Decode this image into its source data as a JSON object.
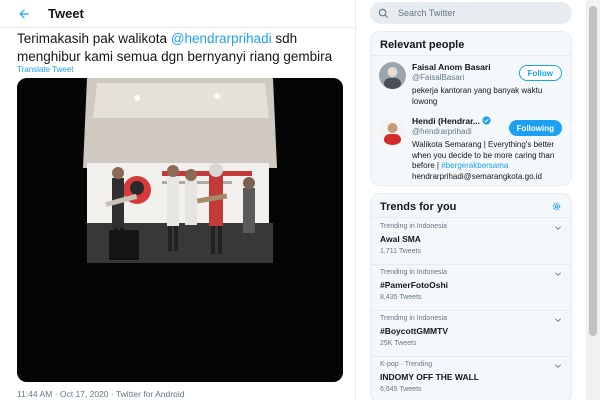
{
  "header": {
    "title": "Tweet"
  },
  "tweet": {
    "text_before": "Terimakasih pak walikota ",
    "mention": "@hendrarprihadi",
    "text_after": " sdh menghibur kami semua dgn bernyanyi riang gembira",
    "translate_label": "Translate Tweet",
    "time": "11:44 AM",
    "date": "Oct 17, 2020",
    "source": "Twitter for Android",
    "sep": " · "
  },
  "search": {
    "placeholder": "Search Twitter"
  },
  "relevant_people": {
    "title": "Relevant people",
    "people": [
      {
        "name": "Faisal Anom Basari",
        "handle": "@FaisalBasari",
        "bio": "pekerja kantoran yang banyak waktu lowong",
        "button": "Follow"
      },
      {
        "name": "Hendi (Hendrar...",
        "handle": "@hendrarprihadi",
        "bio_before": "Walikota Semarang | Everything's better when you decide to be more caring than before | ",
        "bio_tag": "#bergerakbersama",
        "bio_after": " hendrarprihadi@semarangkota.go.id",
        "button": "Following"
      }
    ]
  },
  "trends": {
    "title": "Trends for you",
    "items": [
      {
        "context": "Trending in Indonesia",
        "name": "Awal SMA",
        "count": "1,711 Tweets"
      },
      {
        "context": "Trending in Indonesia",
        "name": "#PamerFotoOshi",
        "count": "8,435 Tweets"
      },
      {
        "context": "Trending in Indonesia",
        "name": "#BoycottGMMTV",
        "count": "25K Tweets"
      },
      {
        "context": "K-pop · Trending",
        "name": "INDOMY OFF THE WALL",
        "count": "6,645 Tweets"
      }
    ]
  },
  "colors": {
    "accent": "#1da1f2",
    "text": "#14171a",
    "muted": "#657786",
    "panel": "#f5f8fa"
  }
}
